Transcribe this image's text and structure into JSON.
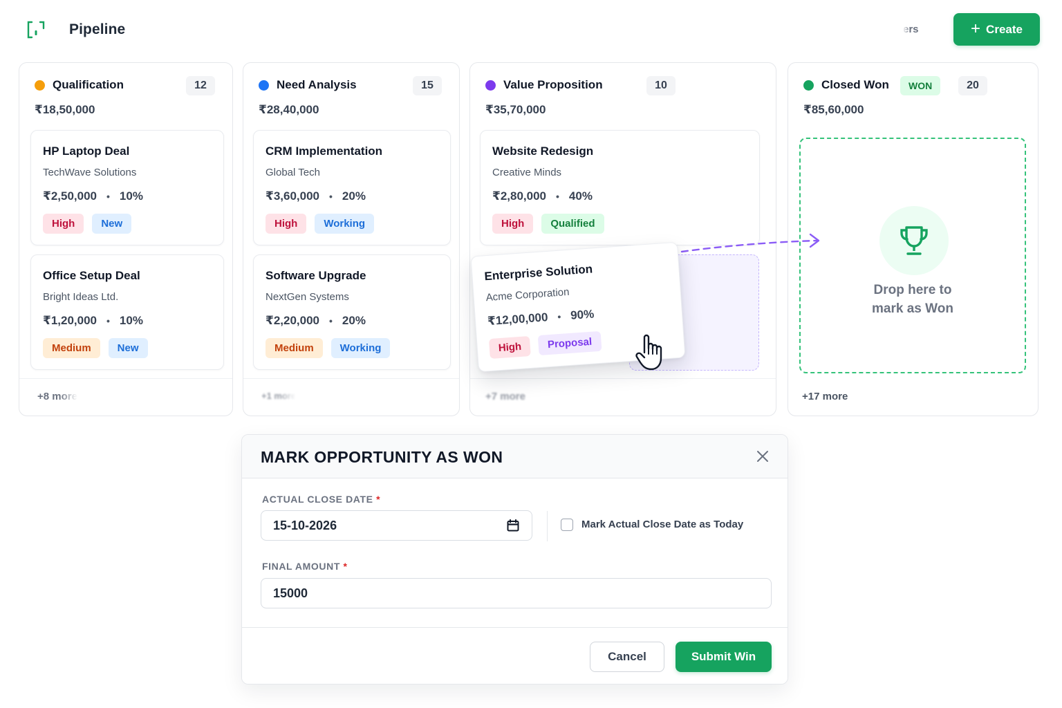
{
  "app": {
    "title": "Pipeline",
    "filters_label": "ers",
    "create_label": "Create",
    "logo_icon": "pipeline-logo-icon"
  },
  "colors": {
    "brand_green": "#16a35f",
    "qualification": "#f59e0b",
    "need_analysis": "#1d74f5",
    "value_proposition": "#7c3aed",
    "closed_won": "#16a35f"
  },
  "columns": [
    {
      "name": "Qualification",
      "count": "12",
      "total": "₹18,50,000",
      "more": "+8 more",
      "cards": [
        {
          "title": "HP Laptop Deal",
          "company": "TechWave Solutions",
          "amount": "₹2,50,000",
          "probability": "10%",
          "priority": "High",
          "status": "New"
        },
        {
          "title": "Office Setup Deal",
          "company": "Bright Ideas Ltd.",
          "amount": "₹1,20,000",
          "probability": "10%",
          "priority": "Medium",
          "status": "New"
        }
      ]
    },
    {
      "name": "Need Analysis",
      "count": "15",
      "total": "₹28,40,000",
      "more": "+1 more",
      "cards": [
        {
          "title": "CRM Implementation",
          "company": "Global Tech",
          "amount": "₹3,60,000",
          "probability": "20%",
          "priority": "High",
          "status": "Working"
        },
        {
          "title": "Software Upgrade",
          "company": "NextGen Systems",
          "amount": "₹2,20,000",
          "probability": "20%",
          "priority": "Medium",
          "status": "Working"
        }
      ]
    },
    {
      "name": "Value Proposition",
      "count": "10",
      "total": "₹35,70,000",
      "more": "+7 more",
      "cards": [
        {
          "title": "Website Redesign",
          "company": "Creative Minds",
          "amount": "₹2,80,000",
          "probability": "40%",
          "priority": "High",
          "status": "Qualified"
        }
      ]
    },
    {
      "name": "Closed Won",
      "badge": "WON",
      "count": "20",
      "total": "₹85,60,000",
      "more": "+17 more",
      "drop_line1": "Drop here to",
      "drop_line2": "mark as Won"
    }
  ],
  "dragging_card": {
    "title": "Enterprise Solution",
    "company": "Acme Corporation",
    "amount": "₹12,00,000",
    "probability": "90%",
    "priority": "High",
    "status": "Proposal"
  },
  "separator": "•",
  "modal": {
    "title": "MARK OPPORTUNITY AS WON",
    "close_date_label": "ACTUAL CLOSE DATE",
    "required_mark": "*",
    "close_date_value": "15-10-2026",
    "today_checkbox_label": "Mark Actual Close Date as Today",
    "today_checked": false,
    "amount_label": "FINAL AMOUNT",
    "amount_value": "15000",
    "cancel_label": "Cancel",
    "submit_label": "Submit Win"
  }
}
